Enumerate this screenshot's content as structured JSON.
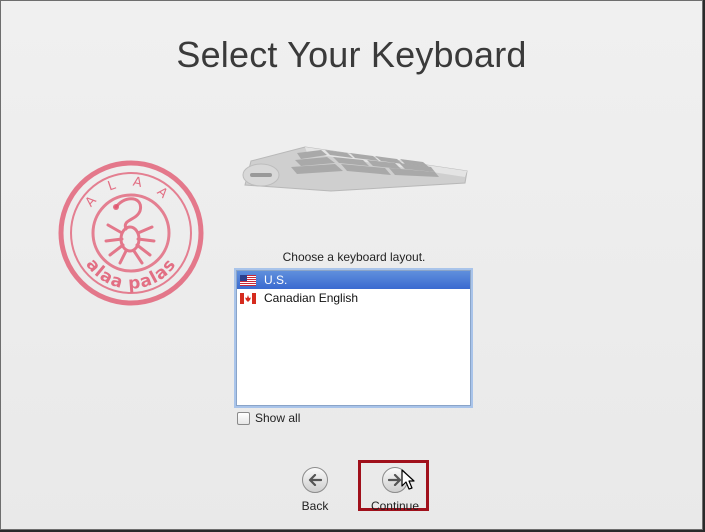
{
  "window": {
    "title": "Select Your Keyboard"
  },
  "stamp": {
    "text_top": "A L A A",
    "text_bottom": "alaa palas",
    "color": "#e0506a"
  },
  "keyboard_image": {
    "icon": "keyboard-icon"
  },
  "layout_chooser": {
    "prompt": "Choose a keyboard layout.",
    "items": [
      {
        "label": "U.S.",
        "flag": "us-flag-icon",
        "selected": true
      },
      {
        "label": "Canadian English",
        "flag": "canada-flag-icon",
        "selected": false
      }
    ],
    "show_all_label": "Show all",
    "show_all_checked": false
  },
  "navigation": {
    "back_label": "Back",
    "continue_label": "Continue",
    "highlight_color": "#a0101b"
  }
}
